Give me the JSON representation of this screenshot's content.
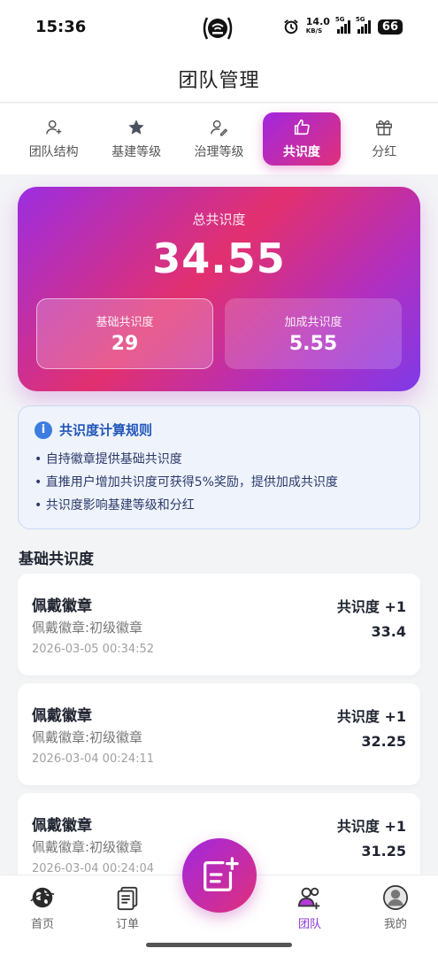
{
  "status_bar": {
    "time": "15:36",
    "net_speed": "14.0",
    "net_unit": "KB/S",
    "sim1_tag": "5G",
    "sim2_tag": "5G",
    "battery": "66"
  },
  "header": {
    "title": "团队管理"
  },
  "tabs": [
    {
      "label": "团队结构",
      "icon": "person-add-icon",
      "active": false
    },
    {
      "label": "基建等级",
      "icon": "star-icon",
      "active": false
    },
    {
      "label": "治理等级",
      "icon": "person-edit-icon",
      "active": false
    },
    {
      "label": "共识度",
      "icon": "thumbs-up-icon",
      "active": true
    },
    {
      "label": "分红",
      "icon": "gift-icon",
      "active": false
    }
  ],
  "summary": {
    "label": "总共识度",
    "value": "34.55",
    "base_label": "基础共识度",
    "base_value": "29",
    "bonus_label": "加成共识度",
    "bonus_value": "5.55"
  },
  "rules": {
    "title": "共识度计算规则",
    "items": [
      "• 自持徽章提供基础共识度",
      "• 直推用户增加共识度可获得5%奖励，提供加成共识度",
      "• 共识度影响基建等级和分红"
    ]
  },
  "section": {
    "title": "基础共识度"
  },
  "records": [
    {
      "title": "佩戴徽章",
      "desc": "佩戴徽章:初级徽章",
      "time": "2026-03-05 00:34:52",
      "badge": "共识度 +1",
      "value": "33.4"
    },
    {
      "title": "佩戴徽章",
      "desc": "佩戴徽章:初级徽章",
      "time": "2026-03-04 00:24:11",
      "badge": "共识度 +1",
      "value": "32.25"
    },
    {
      "title": "佩戴徽章",
      "desc": "佩戴徽章:初级徽章",
      "time": "2026-03-04 00:24:04",
      "badge": "共识度 +1",
      "value": "31.25"
    }
  ],
  "bottom_nav": [
    {
      "label": "首页",
      "icon": "globe-icon",
      "active": false
    },
    {
      "label": "订单",
      "icon": "order-icon",
      "active": false
    },
    {
      "label": "团队",
      "icon": "team-icon",
      "active": true
    },
    {
      "label": "我的",
      "icon": "user-icon",
      "active": false
    }
  ],
  "colors": {
    "accent_purple": "#a127e0",
    "accent_pink": "#e0307a",
    "rules_blue": "#2156b8"
  }
}
